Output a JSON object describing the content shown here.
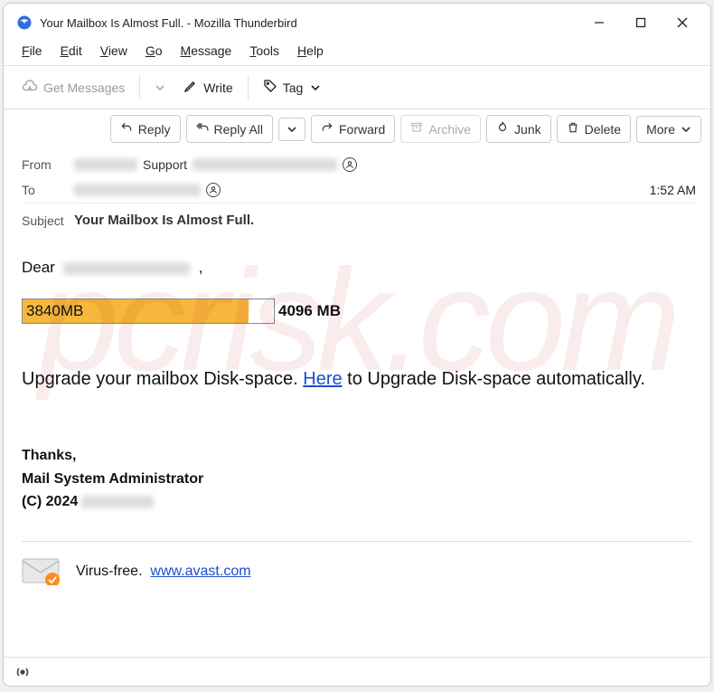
{
  "window": {
    "title": "Your Mailbox Is Almost Full. - Mozilla Thunderbird"
  },
  "menubar": {
    "file": "File",
    "edit": "Edit",
    "view": "View",
    "go": "Go",
    "message": "Message",
    "tools": "Tools",
    "help": "Help"
  },
  "toolbar1": {
    "get_messages": "Get Messages",
    "write": "Write",
    "tag": "Tag"
  },
  "toolbar2": {
    "reply": "Reply",
    "reply_all": "Reply All",
    "forward": "Forward",
    "archive": "Archive",
    "junk": "Junk",
    "delete": "Delete",
    "more": "More"
  },
  "headers": {
    "from_label": "From",
    "from_name": "Support",
    "to_label": "To",
    "subject_label": "Subject",
    "subject": "Your Mailbox Is Almost Full.",
    "time": "1:52 AM"
  },
  "body": {
    "greeting_prefix": "Dear",
    "greeting_suffix": ",",
    "progress_used": "3840MB",
    "progress_total": "4096 MB",
    "upgrade_text_1": "Upgrade your mailbox Disk-space. ",
    "upgrade_link": "Here",
    "upgrade_text_2": "  to Upgrade Disk-space automatically.",
    "thanks": "Thanks,",
    "admin": "Mail System Administrator",
    "copyright_prefix": "(C) 2024",
    "virus_free": "Virus-free.",
    "avast_link": "www.avast.com"
  },
  "watermark": "pcrisk.com"
}
